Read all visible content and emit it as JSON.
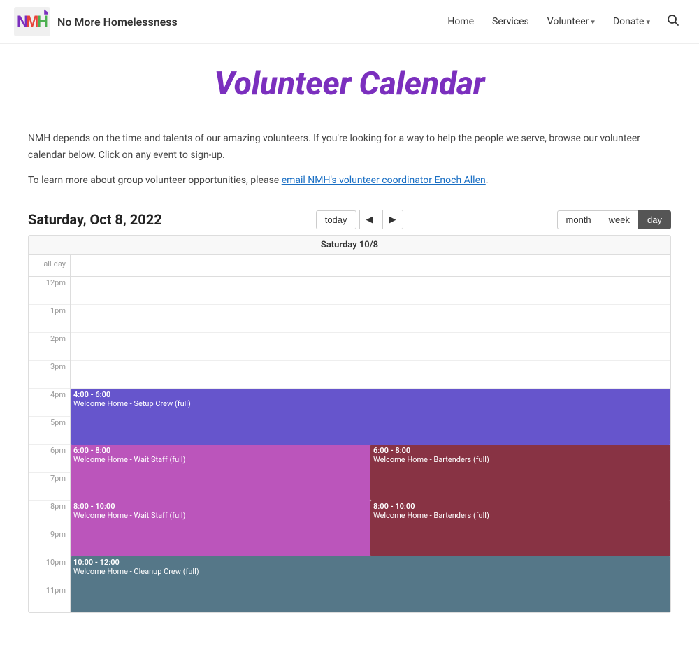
{
  "site": {
    "name": "No More Homelessness",
    "logo_letters": "NMH"
  },
  "nav": {
    "items": [
      {
        "id": "home",
        "label": "Home",
        "has_dropdown": false
      },
      {
        "id": "services",
        "label": "Services",
        "has_dropdown": false
      },
      {
        "id": "volunteer",
        "label": "Volunteer",
        "has_dropdown": true
      },
      {
        "id": "donate",
        "label": "Donate",
        "has_dropdown": true
      }
    ]
  },
  "page": {
    "title": "Volunteer Calendar",
    "description1": "NMH depends on the time and talents of our amazing volunteers. If you're looking for a way to help the people we serve, browse our volunteer calendar below. Click on any event to sign-up.",
    "description2": "To learn more about group volunteer opportunities, please ",
    "link_text": "email NMH's volunteer coordinator Enoch Allen",
    "description2_end": "."
  },
  "calendar": {
    "date_label": "Saturday, Oct 8, 2022",
    "col_header": "Saturday 10/8",
    "today_btn": "today",
    "view_month": "month",
    "view_week": "week",
    "view_day": "day",
    "active_view": "day",
    "time_slots": [
      "all-day",
      "12pm",
      "1pm",
      "2pm",
      "3pm",
      "4pm",
      "5pm",
      "6pm",
      "7pm",
      "8pm",
      "9pm",
      "10pm",
      "11pm"
    ],
    "events": [
      {
        "id": "setup-crew",
        "time_label": "4:00 - 6:00",
        "title": "Welcome Home - Setup Crew (full)",
        "color": "#6655cc",
        "top_slot_index": 4,
        "duration_slots": 2,
        "left_pct": 0,
        "width_pct": 100
      },
      {
        "id": "wait-staff",
        "time_label": "6:00 - 8:00",
        "title": "Welcome Home - Wait Staff (full)",
        "color": "#bb55bb",
        "top_slot_index": 6,
        "duration_slots": 2,
        "left_pct": 0,
        "width_pct": 50
      },
      {
        "id": "bartenders",
        "time_label": "6:00 - 8:00",
        "title": "Welcome Home - Bartenders (full)",
        "color": "#993344",
        "top_slot_index": 6,
        "duration_slots": 2,
        "left_pct": 50,
        "width_pct": 50
      },
      {
        "id": "wait-staff-2",
        "time_label": "8:00 - 10:00",
        "title": "Welcome Home - Wait Staff (full)",
        "color": "#bb55bb",
        "top_slot_index": 8,
        "duration_slots": 2,
        "left_pct": 0,
        "width_pct": 50
      },
      {
        "id": "bartenders-2",
        "time_label": "8:00 - 10:00",
        "title": "Welcome Home - Bartenders (full)",
        "color": "#993344",
        "top_slot_index": 8,
        "duration_slots": 2,
        "left_pct": 50,
        "width_pct": 50
      },
      {
        "id": "cleanup",
        "time_label": "10:00 - 12:00",
        "title": "Welcome Home - Cleanup Crew (full)",
        "color": "#557788",
        "top_slot_index": 10,
        "duration_slots": 2,
        "left_pct": 0,
        "width_pct": 100
      }
    ]
  }
}
